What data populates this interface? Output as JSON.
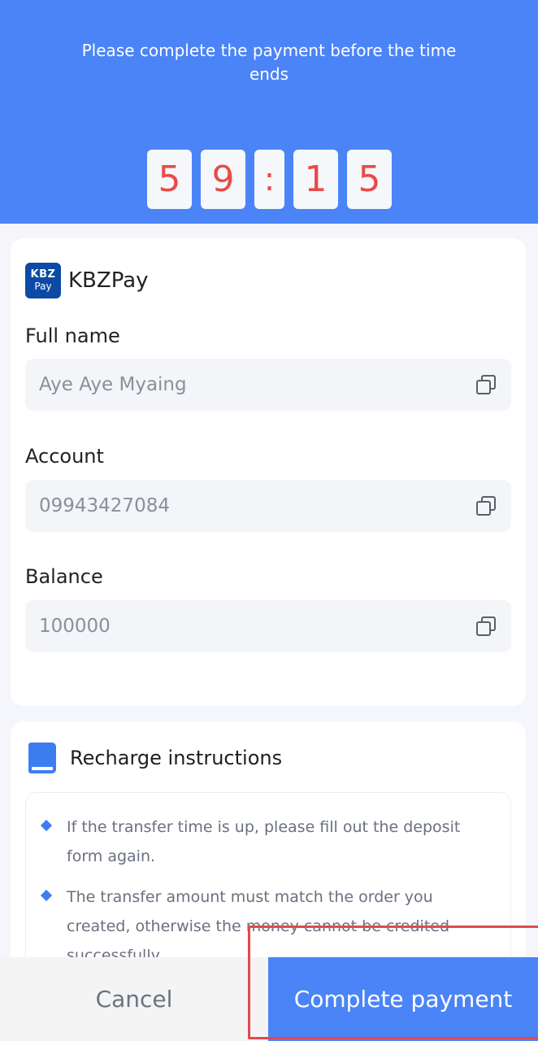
{
  "header": {
    "notice": "Please complete the payment before the time ends",
    "timer": {
      "d1": "5",
      "d2": "9",
      "sep": ":",
      "d3": "1",
      "d4": "5"
    }
  },
  "payment_card": {
    "bank_logo_line1": "KBZ",
    "bank_logo_line2": "Pay",
    "bank_name": "KBZPay",
    "fields": [
      {
        "label": "Full name",
        "value": "Aye Aye Myaing"
      },
      {
        "label": "Account",
        "value": "09943427084"
      },
      {
        "label": "Balance",
        "value": "100000"
      }
    ]
  },
  "instructions": {
    "title": "Recharge instructions",
    "items": [
      "If the transfer time is up, please fill out the deposit form again.",
      "The transfer amount must match the order you created, otherwise the money cannot be credited successfully."
    ]
  },
  "footer": {
    "cancel_label": "Cancel",
    "complete_label": "Complete payment"
  },
  "colors": {
    "brand_blue": "#4b84f7",
    "timer_digit": "#e84b4b",
    "highlight_red": "#e04a4f"
  }
}
